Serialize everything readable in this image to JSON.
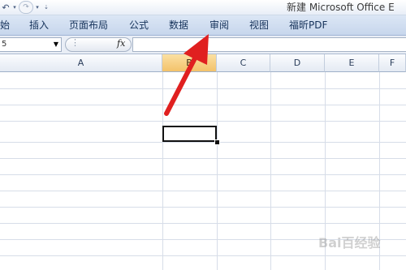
{
  "title_bar": {
    "title": "新建 Microsoft Office E",
    "qat": {
      "undo_icon": "undo-arrow",
      "redo_icon": "redo-arrow",
      "customize_icon": "chevron-down"
    }
  },
  "ribbon": {
    "tabs": [
      {
        "label": "始"
      },
      {
        "label": "插入"
      },
      {
        "label": "页面布局"
      },
      {
        "label": "公式"
      },
      {
        "label": "数据"
      },
      {
        "label": "审阅"
      },
      {
        "label": "视图"
      },
      {
        "label": "福昕PDF"
      }
    ]
  },
  "formula_bar": {
    "name_box_value": "5",
    "fx_label": "fx",
    "formula_value": ""
  },
  "sheet": {
    "columns": [
      {
        "label": "A",
        "selected": false
      },
      {
        "label": "B",
        "selected": true
      },
      {
        "label": "C",
        "selected": false
      },
      {
        "label": "D",
        "selected": false
      },
      {
        "label": "E",
        "selected": false
      },
      {
        "label": "F",
        "selected": false
      }
    ],
    "active_column": "B"
  },
  "annotation": {
    "arrow_color": "#e02020"
  },
  "watermark": "Bai百经验"
}
